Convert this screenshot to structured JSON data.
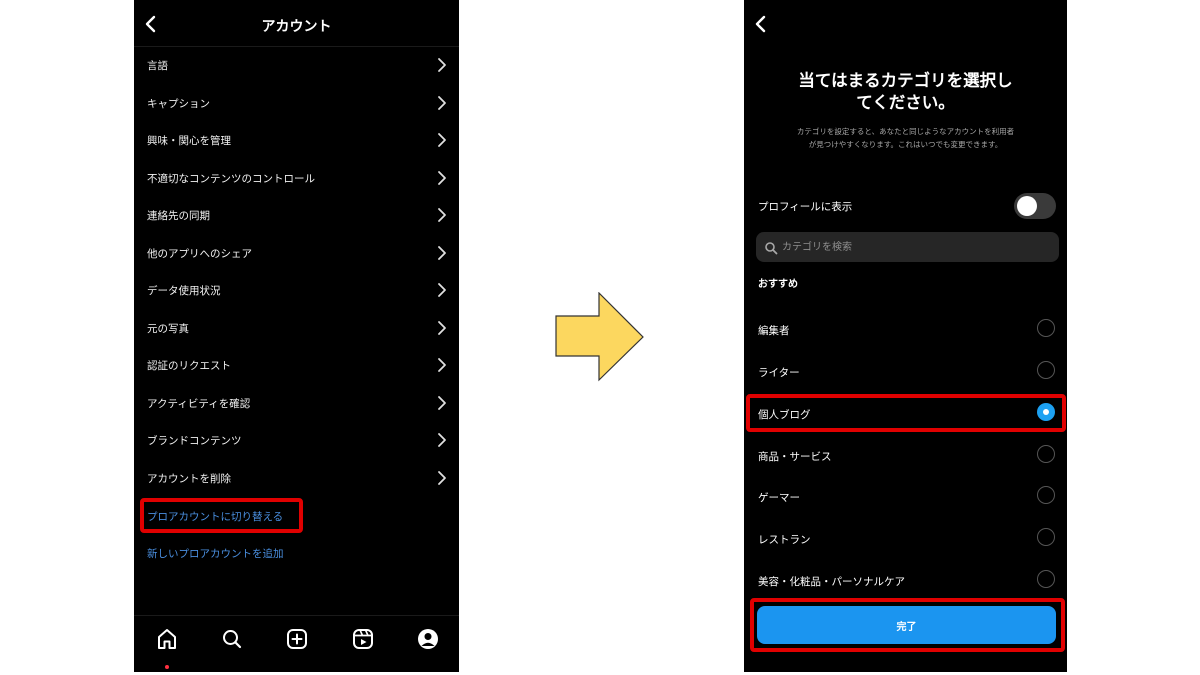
{
  "account_screen": {
    "title": "アカウント",
    "menu_items": [
      {
        "label": "言語"
      },
      {
        "label": "キャプション"
      },
      {
        "label": "興味・関心を管理"
      },
      {
        "label": "不適切なコンテンツのコントロール"
      },
      {
        "label": "連絡先の同期"
      },
      {
        "label": "他のアプリへのシェア"
      },
      {
        "label": "データ使用状況"
      },
      {
        "label": "元の写真"
      },
      {
        "label": "認証のリクエスト"
      },
      {
        "label": "アクティビティを確認"
      },
      {
        "label": "ブランドコンテンツ"
      },
      {
        "label": "アカウントを削除"
      }
    ],
    "switch_link": "プロアカウントに切り替える",
    "add_link": "新しいプロアカウントを追加",
    "tab_bar": [
      "home-icon",
      "search-icon",
      "create-icon",
      "reels-icon",
      "profile-icon"
    ]
  },
  "category_screen": {
    "title_line1": "当てはまるカテゴリを選択し",
    "title_line2": "てください。",
    "description_line1": "カテゴリを設定すると、あなたと同じようなアカウントを利用者",
    "description_line2": "が見つけやすくなります。これはいつでも変更できます。",
    "toggle_label": "プロフィールに表示",
    "toggle_on": false,
    "search_placeholder": "カテゴリを検索",
    "section_label": "おすすめ",
    "categories": [
      {
        "label": "編集者",
        "selected": false
      },
      {
        "label": "ライター",
        "selected": false
      },
      {
        "label": "個人ブログ",
        "selected": true
      },
      {
        "label": "商品・サービス",
        "selected": false
      },
      {
        "label": "ゲーマー",
        "selected": false
      },
      {
        "label": "レストラン",
        "selected": false
      },
      {
        "label": "美容・化粧品・パーソナルケア",
        "selected": false
      }
    ],
    "done_button": "完了"
  },
  "colors": {
    "highlight": "#e00000",
    "link": "#4a8fe0",
    "accent": "#1b95f0",
    "arrow_fill": "#fcd75f"
  }
}
